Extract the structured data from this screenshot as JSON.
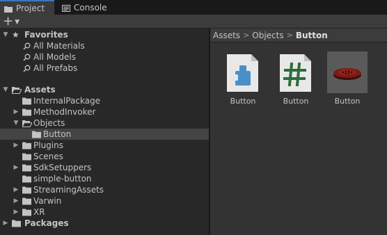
{
  "tabs": [
    {
      "label": "Project",
      "icon": "folder-icon",
      "active": true
    },
    {
      "label": "Console",
      "icon": "console-icon",
      "active": false
    }
  ],
  "toolbar": {
    "add_icon": "plus-icon",
    "add_caret": "caret-down-icon"
  },
  "tree": {
    "favorites": {
      "label": "Favorites",
      "items": [
        "All Materials",
        "All Models",
        "All Prefabs"
      ]
    },
    "assets": {
      "label": "Assets",
      "children": [
        {
          "label": "InternalPackage",
          "expandable": false
        },
        {
          "label": "MethodInvoker",
          "expandable": true
        },
        {
          "label": "Objects",
          "expandable": true,
          "expanded": true
        },
        {
          "label": "Button",
          "expandable": false,
          "selected": true
        },
        {
          "label": "Plugins",
          "expandable": true
        },
        {
          "label": "Scenes",
          "expandable": false
        },
        {
          "label": "SdkSetuppers",
          "expandable": true
        },
        {
          "label": "simple-button",
          "expandable": false
        },
        {
          "label": "StreamingAssets",
          "expandable": true
        },
        {
          "label": "Varwin",
          "expandable": true
        },
        {
          "label": "XR",
          "expandable": true
        }
      ]
    },
    "packages": {
      "label": "Packages"
    }
  },
  "breadcrumb": {
    "items": [
      "Assets",
      "Objects"
    ],
    "current": "Button"
  },
  "assets_grid": [
    {
      "name": "Button",
      "icon": "script-asset-icon"
    },
    {
      "name": "Button",
      "icon": "csharp-script-icon"
    },
    {
      "name": "Button",
      "icon": "prefab-preview-icon",
      "selected": true
    }
  ],
  "colors": {
    "accent": "#3a79bb",
    "folder": "#c4c4c4",
    "csharp_hash": "#2b6e39",
    "script_blue": "#4a90c8",
    "button_red": "#7a1a14"
  }
}
